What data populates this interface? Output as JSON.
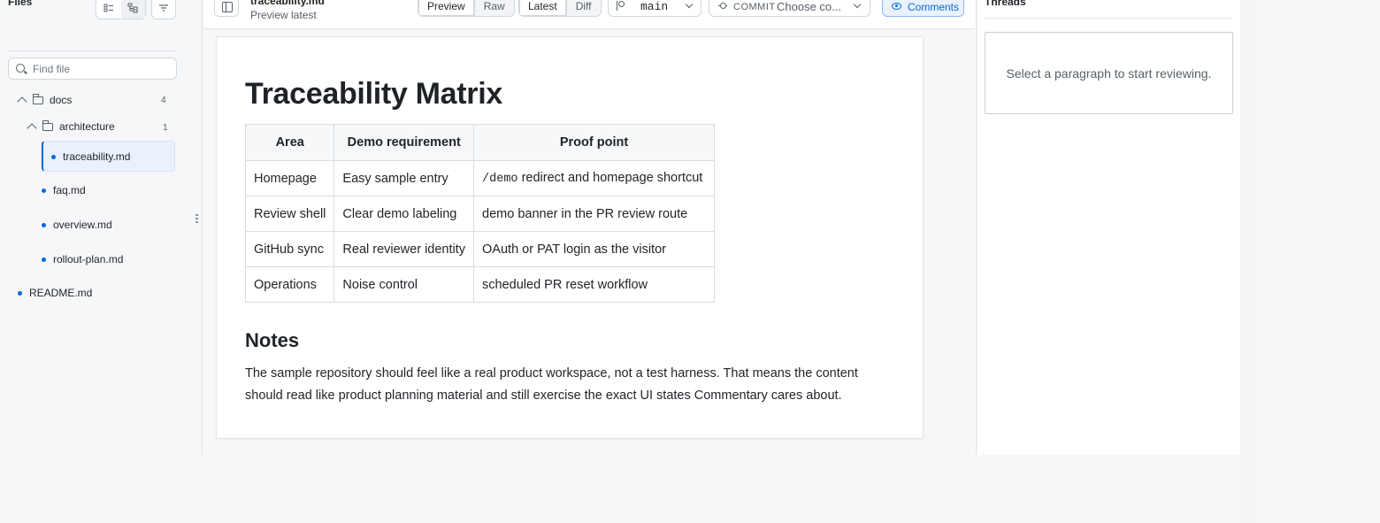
{
  "sidebar": {
    "title": "Files",
    "search_placeholder": "Find file",
    "tree": {
      "docs": {
        "label": "docs",
        "count": "4"
      },
      "architecture": {
        "label": "architecture",
        "count": "1"
      },
      "files": [
        {
          "label": "traceability.md",
          "active": true
        },
        {
          "label": "faq.md"
        },
        {
          "label": "overview.md"
        },
        {
          "label": "rollout-plan.md"
        },
        {
          "label": "README.md"
        }
      ]
    }
  },
  "toolbar": {
    "file_title": "traceability.md",
    "file_subtitle": "Preview latest",
    "view_modes": [
      "Preview",
      "Raw"
    ],
    "active_view": "Preview",
    "compare_modes": [
      "Latest",
      "Diff"
    ],
    "active_compare": "Latest",
    "branch": "main",
    "commit_label": "COMMIT",
    "commit_value": "Choose co...",
    "comments_label": "Comments"
  },
  "document": {
    "title": "Traceability Matrix",
    "table": {
      "headers": [
        "Area",
        "Demo requirement",
        "Proof point"
      ],
      "rows": [
        {
          "area": "Homepage",
          "requirement": "Easy sample entry",
          "proof_code": "/demo",
          "proof_rest": " redirect and homepage shortcut"
        },
        {
          "area": "Review shell",
          "requirement": "Clear demo labeling",
          "proof": "demo banner in the PR review route"
        },
        {
          "area": "GitHub sync",
          "requirement": "Real reviewer identity",
          "proof": "OAuth or PAT login as the visitor"
        },
        {
          "area": "Operations",
          "requirement": "Noise control",
          "proof": "scheduled PR reset workflow"
        }
      ]
    },
    "notes_heading": "Notes",
    "notes_body": "The sample repository should feel like a real product workspace, not a test harness. That means the content should read like product planning material and still exercise the exact UI states Commentary cares about."
  },
  "threads": {
    "title": "Threads",
    "empty_message": "Select a paragraph to start reviewing."
  },
  "colors": {
    "accent": "#0969da",
    "active_file_bg": "#eaf1fb",
    "border": "#d8dce0"
  }
}
